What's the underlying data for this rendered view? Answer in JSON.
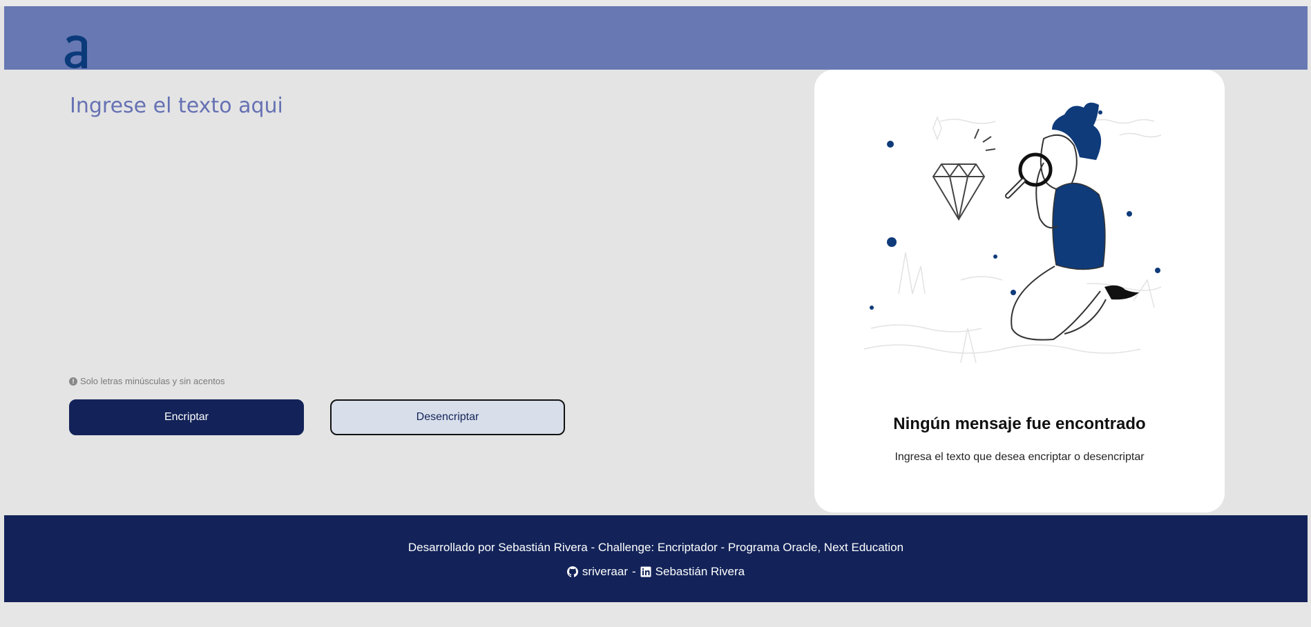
{
  "header": {
    "logo_icon": "alura-a-logo-icon",
    "logo_letter": "a",
    "background": "#6778b3"
  },
  "input": {
    "placeholder": "Ingrese el texto aqui",
    "value": ""
  },
  "hint": {
    "icon": "info-icon",
    "text": "Solo letras minúsculas y sin acentos"
  },
  "buttons": {
    "encrypt_label": "Encriptar",
    "decrypt_label": "Desencriptar"
  },
  "output": {
    "illustration_icon": "person-magnifying-glass-illustration",
    "title": "Ningún mensaje fue encontrado",
    "subtitle": "Ingresa el texto que desea encriptar o desencriptar"
  },
  "footer": {
    "credits": "Desarrollado por Sebastián Rivera - Challenge: Encriptador - Programa Oracle, Next Education",
    "github_icon": "github-icon",
    "github_user": "sriveraar",
    "separator": "-",
    "linkedin_icon": "linkedin-icon",
    "linkedin_name": "Sebastián Rivera"
  },
  "colors": {
    "primary": "#132359",
    "accent": "#6671b3",
    "background": "#e4e4e4"
  }
}
